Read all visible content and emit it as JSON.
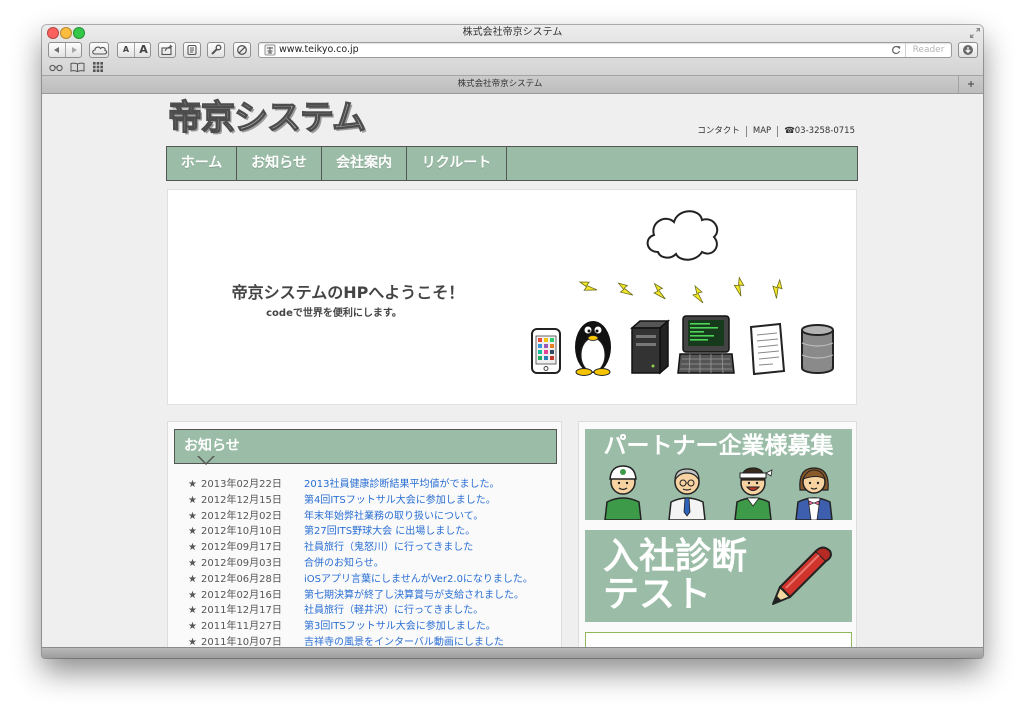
{
  "window": {
    "title": "株式会社帝京システム"
  },
  "toolbar": {
    "text_size_small": "A",
    "text_size_large": "A",
    "url": "www.teikyo.co.jp",
    "reader_label": "Reader"
  },
  "tab": {
    "title": "株式会社帝京システム"
  },
  "site": {
    "logo": "帝京システム",
    "header_links": {
      "contact": "コンタクト",
      "map": "MAP",
      "phone": "☎03-3258-0715"
    },
    "nav": [
      {
        "label": "ホーム"
      },
      {
        "label": "お知らせ"
      },
      {
        "label": "会社案内"
      },
      {
        "label": "リクルート"
      }
    ],
    "hero": {
      "title": "帝京システムのHPへようこそ！",
      "subtitle": "codeで世界を便利にします。"
    },
    "news": {
      "heading": "お知らせ",
      "items": [
        {
          "date": "2013年02月22日",
          "title": "2013社員健康診断結果平均値がでました。"
        },
        {
          "date": "2012年12月15日",
          "title": "第4回ITSフットサル大会に参加しました。"
        },
        {
          "date": "2012年12月02日",
          "title": "年末年始弊社業務の取り扱いについて。"
        },
        {
          "date": "2012年10月10日",
          "title": "第27回ITS野球大会 に出場しました。"
        },
        {
          "date": "2012年09月17日",
          "title": "社員旅行（鬼怒川）に行ってきました"
        },
        {
          "date": "2012年09月03日",
          "title": "合併のお知らせ。"
        },
        {
          "date": "2012年06月28日",
          "title": "iOSアプリ言葉にしませんがVer2.0になりました。"
        },
        {
          "date": "2012年02月16日",
          "title": "第七期決算が終了し決算賞与が支給されました。"
        },
        {
          "date": "2011年12月17日",
          "title": "社員旅行（軽井沢）に行ってきました。"
        },
        {
          "date": "2011年11月27日",
          "title": "第3回ITSフットサル大会に参加しました。"
        },
        {
          "date": "2011年10月07日",
          "title": "吉祥寺の風景をインターバル動画にしました"
        }
      ]
    },
    "banners": {
      "partner": "パートナー企業様募集",
      "entrance_test_line1": "入社診断",
      "entrance_test_line2": "テスト"
    }
  },
  "icons": {
    "toolbar": [
      "back-icon",
      "forward-icon",
      "icloud-tabs-icon",
      "share-icon",
      "extension-icon",
      "tools-icon",
      "block-icon",
      "site-favicon-icon",
      "reload-icon",
      "downloads-icon"
    ],
    "bookmarks_bar": [
      "reading-list-icon",
      "bookmarks-icon",
      "top-sites-icon"
    ],
    "hero_illustration": [
      "cloud-icon",
      "lightning-icon",
      "smartphone-icon",
      "penguin-icon",
      "server-icon",
      "terminal-icon",
      "document-icon",
      "database-icon"
    ]
  },
  "colors": {
    "accent_green": "#9bbda7",
    "link_blue": "#2b6fd3",
    "border_dark": "#555555",
    "page_bg": "#efefef",
    "traffic_close": "#fc615d",
    "traffic_minimize": "#fdbc40",
    "traffic_zoom": "#34c84a"
  }
}
